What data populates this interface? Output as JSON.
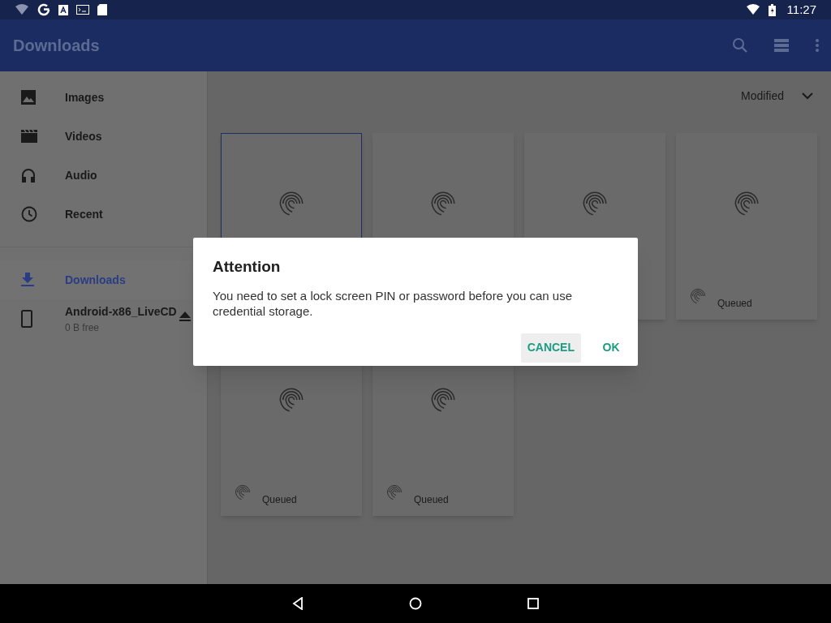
{
  "status_bar": {
    "time": "11:27"
  },
  "app_bar": {
    "title": "Downloads"
  },
  "sidebar": {
    "items": [
      {
        "kind": "images",
        "label": "Images",
        "selected": false
      },
      {
        "kind": "videos",
        "label": "Videos",
        "selected": false
      },
      {
        "kind": "audio",
        "label": "Audio",
        "selected": false
      },
      {
        "kind": "recent",
        "label": "Recent",
        "selected": false
      },
      {
        "kind": "downloads",
        "label": "Downloads",
        "selected": true
      },
      {
        "kind": "device",
        "label": "Android-x86_LiveCD",
        "subtitle": "0 B free",
        "selected": false
      }
    ]
  },
  "sort": {
    "label": "Modified"
  },
  "files": [
    {
      "selected": true
    },
    {
      "selected": false
    },
    {
      "selected": false
    },
    {
      "selected": false,
      "status": "Queued"
    },
    {
      "selected": false,
      "status": "Queued"
    },
    {
      "selected": false,
      "status": "Queued"
    }
  ],
  "dialog": {
    "title": "Attention",
    "message": "You need to set a lock screen PIN or password before you can use credential storage.",
    "buttons": [
      {
        "label": "CANCEL",
        "selected": true
      },
      {
        "label": "OK",
        "selected": false
      }
    ]
  }
}
